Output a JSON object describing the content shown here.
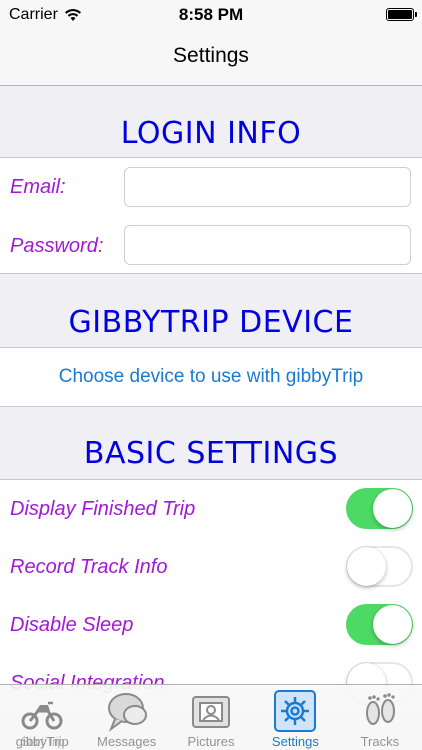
{
  "status_bar": {
    "carrier": "Carrier",
    "time": "8:58 PM"
  },
  "nav": {
    "title": "Settings"
  },
  "login": {
    "header": "LOGIN INFO",
    "email_label": "Email:",
    "email_value": "",
    "password_label": "Password:",
    "password_value": ""
  },
  "device": {
    "header": "GIBBYTRIP DEVICE",
    "choose_label": "Choose device to use with gibbyTrip"
  },
  "basic": {
    "header": "BASIC SETTINGS",
    "items": [
      {
        "label": "Display Finished Trip",
        "on": true
      },
      {
        "label": "Record Track Info",
        "on": false
      },
      {
        "label": "Disable Sleep",
        "on": true
      },
      {
        "label": "Social Integration",
        "on": false
      }
    ]
  },
  "tabs": [
    {
      "label": "gibbyTrip",
      "overlap_label": "Start Trip",
      "icon": "motorcycle-icon",
      "active": false
    },
    {
      "label": "Messages",
      "icon": "chat-bubbles-icon",
      "active": false
    },
    {
      "label": "Pictures",
      "icon": "photo-frame-icon",
      "active": false
    },
    {
      "label": "Settings",
      "icon": "gear-icon",
      "active": true
    },
    {
      "label": "Tracks",
      "icon": "footprints-icon",
      "active": false
    }
  ],
  "colors": {
    "accent": "#1a79d1",
    "header": "#0000e0",
    "label": "#a318d6",
    "toggle_on": "#4cd964"
  }
}
